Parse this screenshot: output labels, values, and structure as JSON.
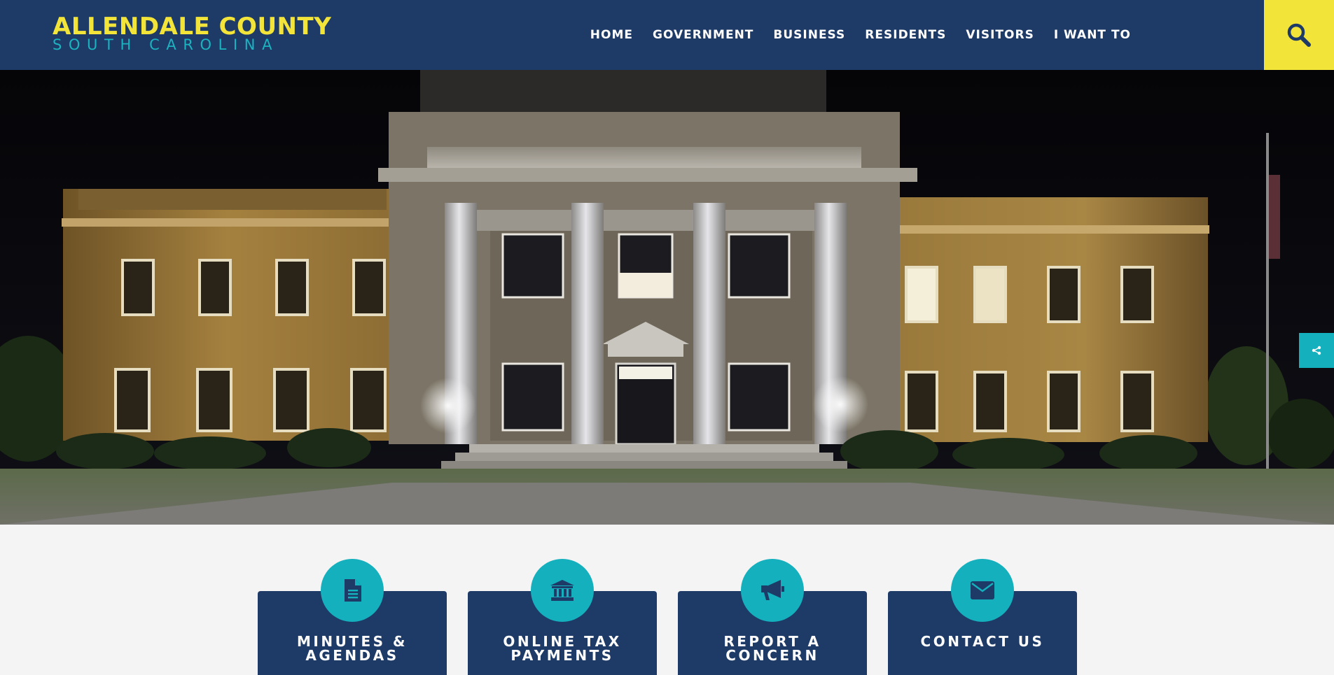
{
  "header": {
    "logo_title": "ALLENDALE COUNTY",
    "logo_subtitle": "SOUTH CAROLINA",
    "nav": [
      {
        "label": "HOME"
      },
      {
        "label": "GOVERNMENT"
      },
      {
        "label": "BUSINESS"
      },
      {
        "label": "RESIDENTS"
      },
      {
        "label": "VISITORS"
      },
      {
        "label": "I WANT TO"
      }
    ],
    "search_icon": "search-icon"
  },
  "hero": {
    "image": "courthouse-at-night",
    "share_icon": "share-icon"
  },
  "quick_links": [
    {
      "label": "MINUTES & AGENDAS",
      "icon": "document-icon"
    },
    {
      "label": "ONLINE TAX PAYMENTS",
      "icon": "bank-icon"
    },
    {
      "label": "REPORT A CONCERN",
      "icon": "megaphone-icon"
    },
    {
      "label": "CONTACT US",
      "icon": "envelope-icon"
    }
  ],
  "colors": {
    "navy": "#1e3a66",
    "yellow": "#f3e43a",
    "teal": "#14b0bd"
  }
}
